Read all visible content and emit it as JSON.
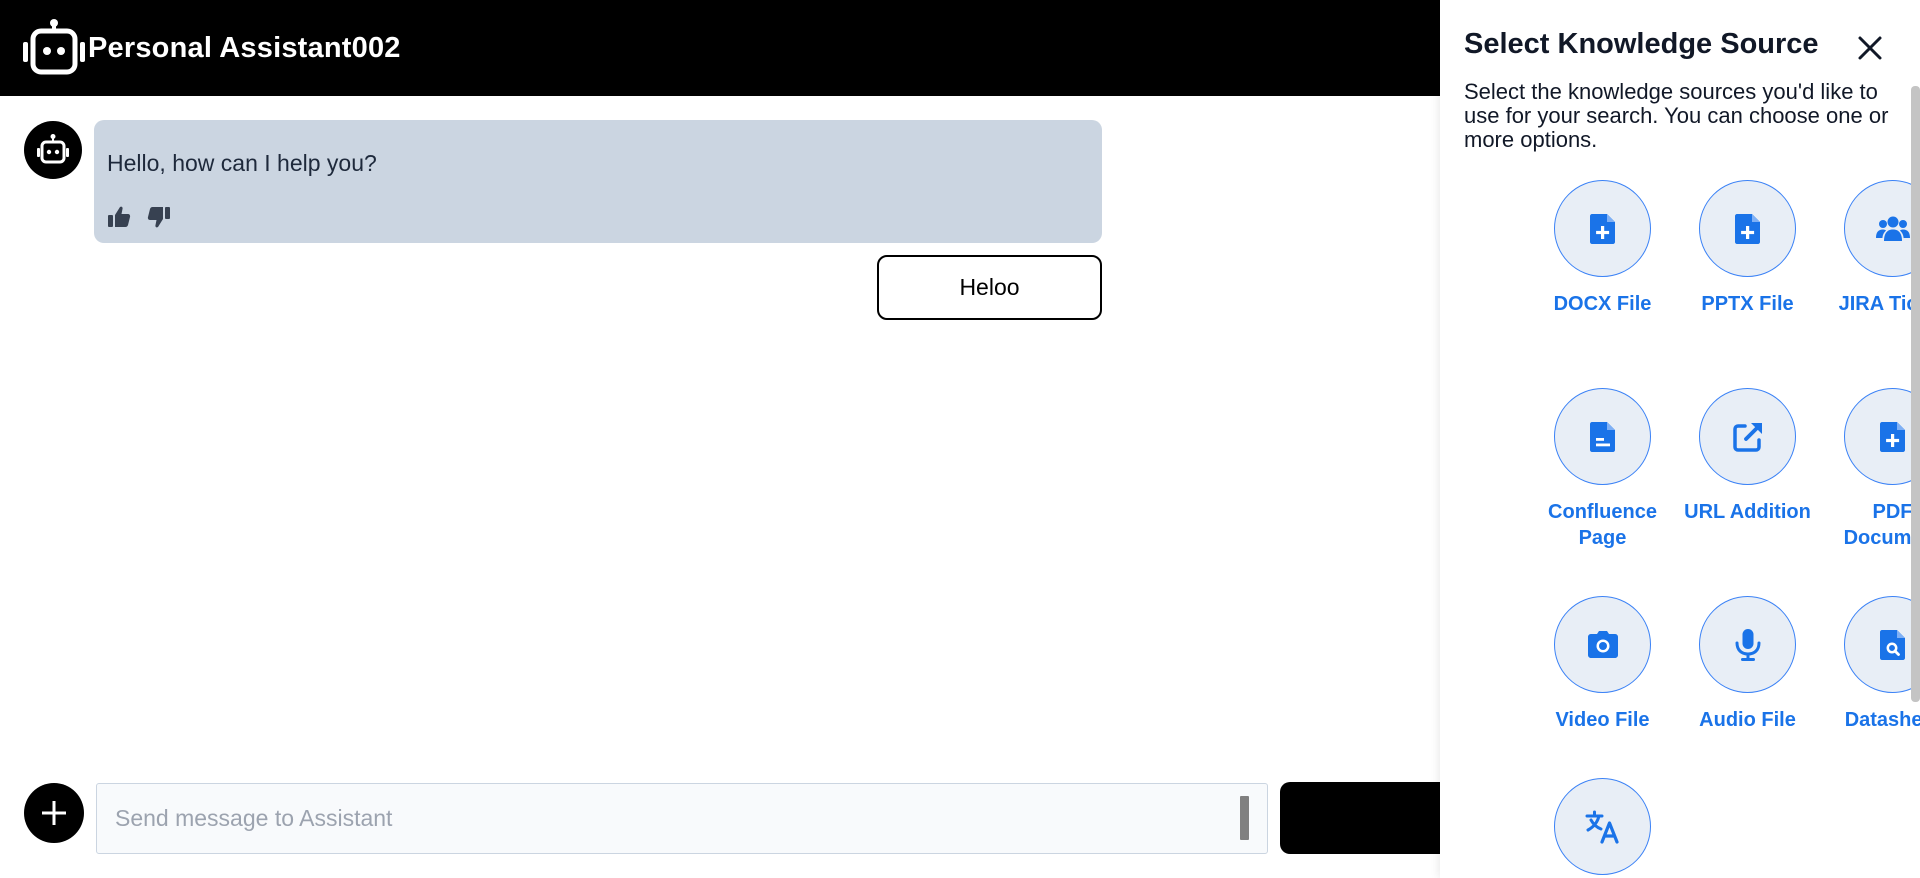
{
  "header": {
    "title": "Personal Assistant002"
  },
  "chat": {
    "messages": [
      {
        "role": "assistant",
        "text": "Hello, how can I help you?"
      },
      {
        "role": "user",
        "text": "Heloo"
      }
    ]
  },
  "composer": {
    "placeholder": "Send message to Assistant",
    "value": ""
  },
  "panel": {
    "title": "Select Knowledge Source",
    "description": "Select the knowledge sources you'd like to use for your search. You can choose one or more options.",
    "sources": [
      {
        "label": "DOCX File",
        "icon": "file-plus-icon"
      },
      {
        "label": "PPTX File",
        "icon": "file-plus-icon"
      },
      {
        "label": "JIRA Ticket",
        "icon": "users-icon"
      },
      {
        "label": "Confluence Page",
        "icon": "file-lines-icon"
      },
      {
        "label": "URL Addition",
        "icon": "external-link-icon"
      },
      {
        "label": "PDF Document",
        "icon": "file-plus-icon"
      },
      {
        "label": "Video File",
        "icon": "camera-icon"
      },
      {
        "label": "Audio File",
        "icon": "microphone-icon"
      },
      {
        "label": "Datasheet",
        "icon": "file-search-icon"
      },
      {
        "label": "",
        "icon": "translate-icon"
      }
    ]
  },
  "colors": {
    "accent": "#1a73e8",
    "bubble": "#cbd5e1",
    "header": "#000000"
  }
}
